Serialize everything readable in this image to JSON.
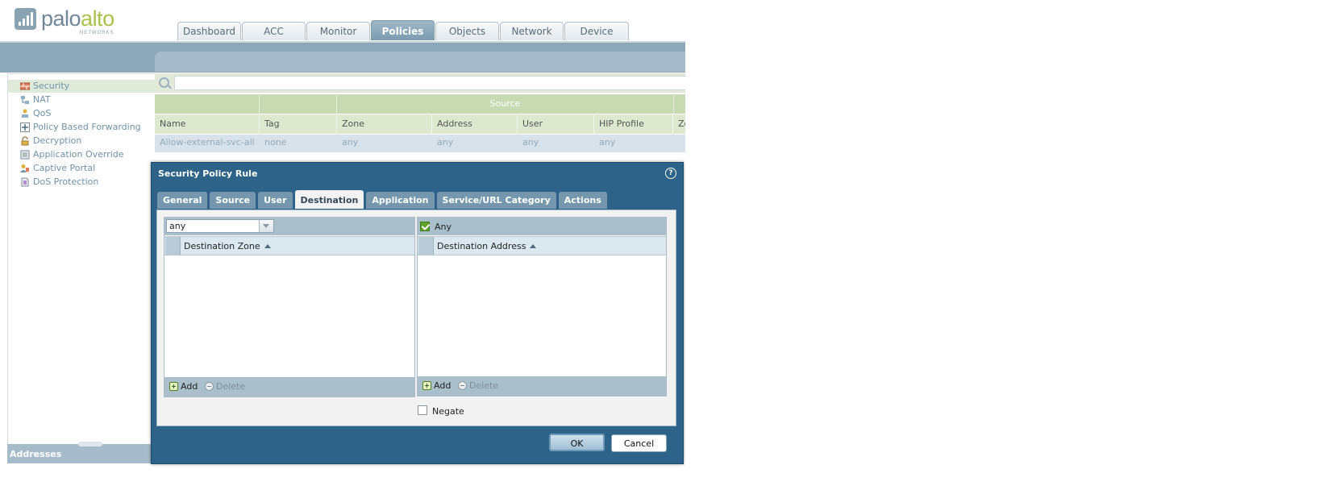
{
  "logo": {
    "main_a": "palo",
    "main_b": "alto",
    "sub": "NETWORKS"
  },
  "nav_tabs": [
    {
      "label": "Dashboard"
    },
    {
      "label": "ACC"
    },
    {
      "label": "Monitor"
    },
    {
      "label": "Policies",
      "active": true
    },
    {
      "label": "Objects"
    },
    {
      "label": "Network"
    },
    {
      "label": "Device"
    }
  ],
  "sidebar": {
    "items": [
      {
        "label": "Security",
        "icon": "security-rule-icon",
        "selected": true
      },
      {
        "label": "NAT",
        "icon": "nat-icon"
      },
      {
        "label": "QoS",
        "icon": "qos-icon"
      },
      {
        "label": "Policy Based Forwarding",
        "icon": "forwarding-icon"
      },
      {
        "label": "Decryption",
        "icon": "lock-icon"
      },
      {
        "label": "Application Override",
        "icon": "override-icon"
      },
      {
        "label": "Captive Portal",
        "icon": "portal-icon"
      },
      {
        "label": "DoS Protection",
        "icon": "dos-icon"
      }
    ],
    "bottom_label": "Addresses"
  },
  "table": {
    "group_header": "Source",
    "columns": [
      "Name",
      "Tag",
      "Zone",
      "Address",
      "User",
      "HIP Profile",
      "Zo"
    ],
    "row": [
      "Allow-external-svc-all",
      "none",
      "any",
      "any",
      "any",
      "any"
    ]
  },
  "dialog": {
    "title": "Security Policy Rule",
    "tabs": [
      {
        "label": "General"
      },
      {
        "label": "Source"
      },
      {
        "label": "User"
      },
      {
        "label": "Destination",
        "active": true
      },
      {
        "label": "Application"
      },
      {
        "label": "Service/URL Category"
      },
      {
        "label": "Actions"
      }
    ],
    "left_panel": {
      "select_value": "any",
      "column": "Destination Zone",
      "add_label": "Add",
      "delete_label": "Delete"
    },
    "right_panel": {
      "any_label": "Any",
      "any_checked": true,
      "column": "Destination Address",
      "add_label": "Add",
      "delete_label": "Delete"
    },
    "negate_label": "Negate",
    "negate_checked": false,
    "ok_label": "OK",
    "cancel_label": "Cancel"
  },
  "colors": {
    "accent": "#2e6389",
    "brand_gray": "#6f8796",
    "brand_green": "#a8c24a",
    "selection": "#e0ead8"
  }
}
